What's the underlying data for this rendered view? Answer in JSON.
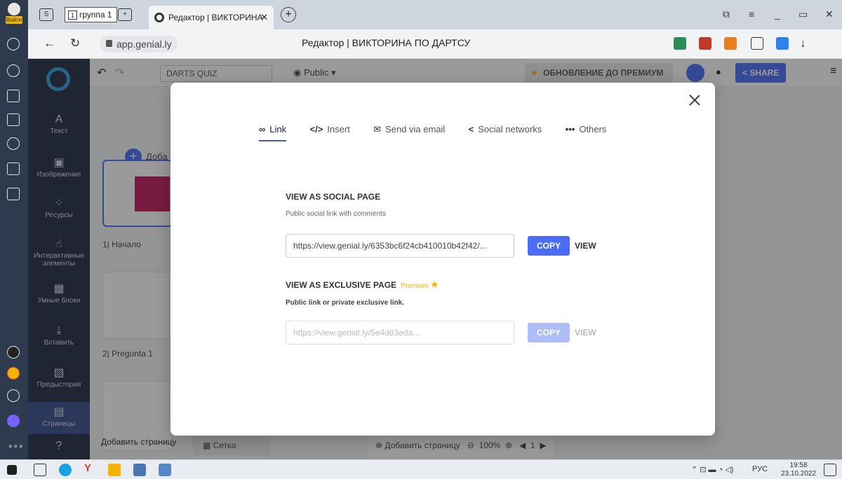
{
  "browser": {
    "enter_label": "Войти",
    "group_tab_label": "группа 1",
    "group_tab_number": "1",
    "active_tab_title": "Редактор | ВИКТОРИНА",
    "address": "app.genial.ly",
    "page_title": "Редактор | ВИКТОРИНА ПО ДАРТСУ"
  },
  "editor": {
    "project_name": "DARTS QUIZ",
    "visibility": "Public",
    "premium_button": "ОБНОВЛЕНИЕ ДО ПРЕМИУМ",
    "share_button": "SHARE",
    "add_label": "Доба",
    "sidebar": {
      "text": "Текст",
      "image": "Изображение",
      "resources": "Ресурсы",
      "interactive": "Интерактивные элементы",
      "smart_blocks": "Умные блоки",
      "insert": "Вставить",
      "prehistory": "Предыстория",
      "pages": "Страницы"
    },
    "pages": [
      {
        "label": "1| Начало"
      },
      {
        "label": "2| Pregunta 1"
      }
    ],
    "bottom": {
      "add_page": "Добавить страницу",
      "grid": "Сетка",
      "add_page_center": "Добавить страницу",
      "zoom": "100%",
      "page_number": "1"
    }
  },
  "modal": {
    "tabs": [
      {
        "label": "Link",
        "icon": "link-icon"
      },
      {
        "label": "Insert",
        "icon": "code-icon"
      },
      {
        "label": "Send via email",
        "icon": "mail-icon"
      },
      {
        "label": "Social networks",
        "icon": "share-icon"
      },
      {
        "label": "Others",
        "icon": "more-icon"
      }
    ],
    "social": {
      "title": "VIEW AS SOCIAL PAGE",
      "description": "Public social link with comments",
      "url": "https://view.genial.ly/6353bc6f24cb410010b42f42/...",
      "copy": "COPY",
      "view": "VIEW"
    },
    "exclusive": {
      "title": "VIEW AS EXCLUSIVE PAGE",
      "premium": "Premium",
      "description": "Public link or private exclusive link.",
      "url": "https://view.genial.ly/5e4d83eda...",
      "copy": "COPY",
      "view": "VIEW"
    }
  },
  "taskbar": {
    "lang": "РУС",
    "time": "19:58",
    "date": "23.10.2022"
  },
  "colors": {
    "accent": "#4a6cf7",
    "sidebar": "#1f2a44",
    "premium": "#f0b400"
  }
}
